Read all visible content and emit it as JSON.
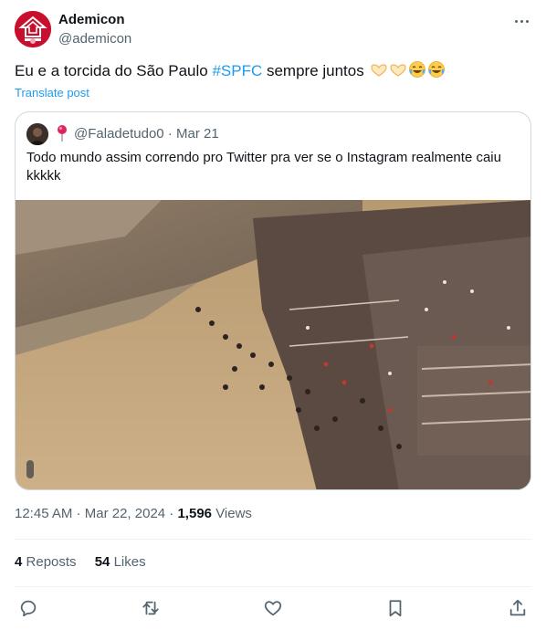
{
  "author": {
    "name": "Ademicon",
    "handle": "@ademicon",
    "avatar_color": "#c8102e"
  },
  "tweet": {
    "text_before": "Eu e a torcida do São Paulo ",
    "hashtag": "#SPFC",
    "text_after": " sempre juntos",
    "emojis": [
      "handshake-heart-icon",
      "handshake-heart-icon",
      "tears-of-joy-icon",
      "tears-of-joy-icon"
    ],
    "translate_label": "Translate post"
  },
  "quote": {
    "handle": "@Faladetudo0",
    "date": "Mar 21",
    "text": "Todo mundo assim correndo pro Twitter pra ver se o Instagram realmente caiu kkkkk"
  },
  "meta": {
    "time": "12:45 AM",
    "date": "Mar 22, 2024",
    "views_count": "1,596",
    "views_label": "Views"
  },
  "stats": {
    "reposts_count": "4",
    "reposts_label": "Reposts",
    "likes_count": "54",
    "likes_label": "Likes"
  },
  "actions": [
    "reply-icon",
    "repost-icon",
    "like-icon",
    "bookmark-icon",
    "share-icon"
  ],
  "colors": {
    "accent": "#1d9bf0",
    "text": "#0f1419",
    "secondary": "#536471",
    "border": "#cfd9de"
  }
}
